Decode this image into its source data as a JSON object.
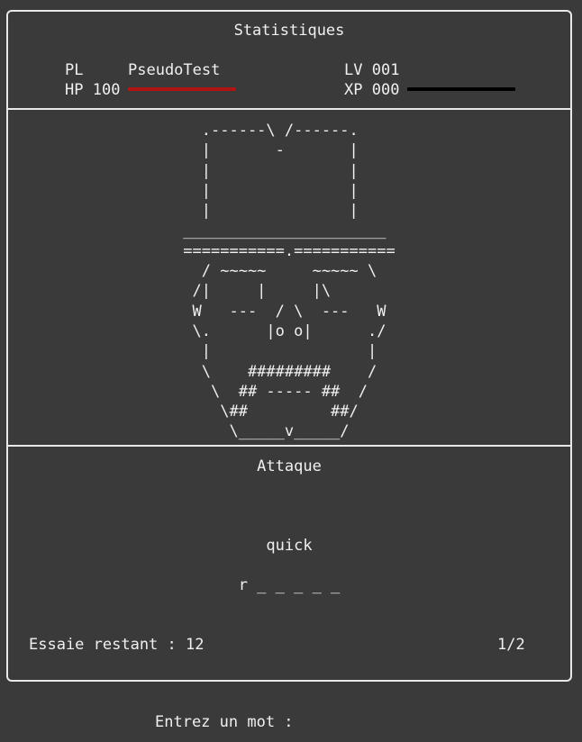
{
  "stats": {
    "title": "Statistiques",
    "player_label": "PL",
    "player_name": "PseudoTest",
    "level_label": "LV",
    "level_value": "001",
    "hp_label": "HP",
    "hp_value": "100",
    "xp_label": "XP",
    "xp_value": "000",
    "hp_fill": 1.0,
    "xp_fill": 1.0,
    "hp_color": "#b01414",
    "xp_color": "#000000"
  },
  "monster": {
    "ascii_art": "  .------\\ /------.\n  |       -       |\n  |               |\n  |               |\n  |               |\n______________________\n===========.===========\n  / ~~~~~     ~~~~~ \\\n /|     |     |\\\n W   ---  / \\  ---   W\n \\.      |o o|      ./\n  |                 |\n  \\    #########    /\n   \\  ## ----- ##  /\n    \\##         ##/\n     \\_____v_____/"
  },
  "attack": {
    "title": "Attaque",
    "word": "quick",
    "pattern": "r _ _ _ _ _",
    "tries_text": "Essaie restant : 12",
    "page": "1/2"
  },
  "prompt": {
    "label": "Entrez un mot :"
  }
}
